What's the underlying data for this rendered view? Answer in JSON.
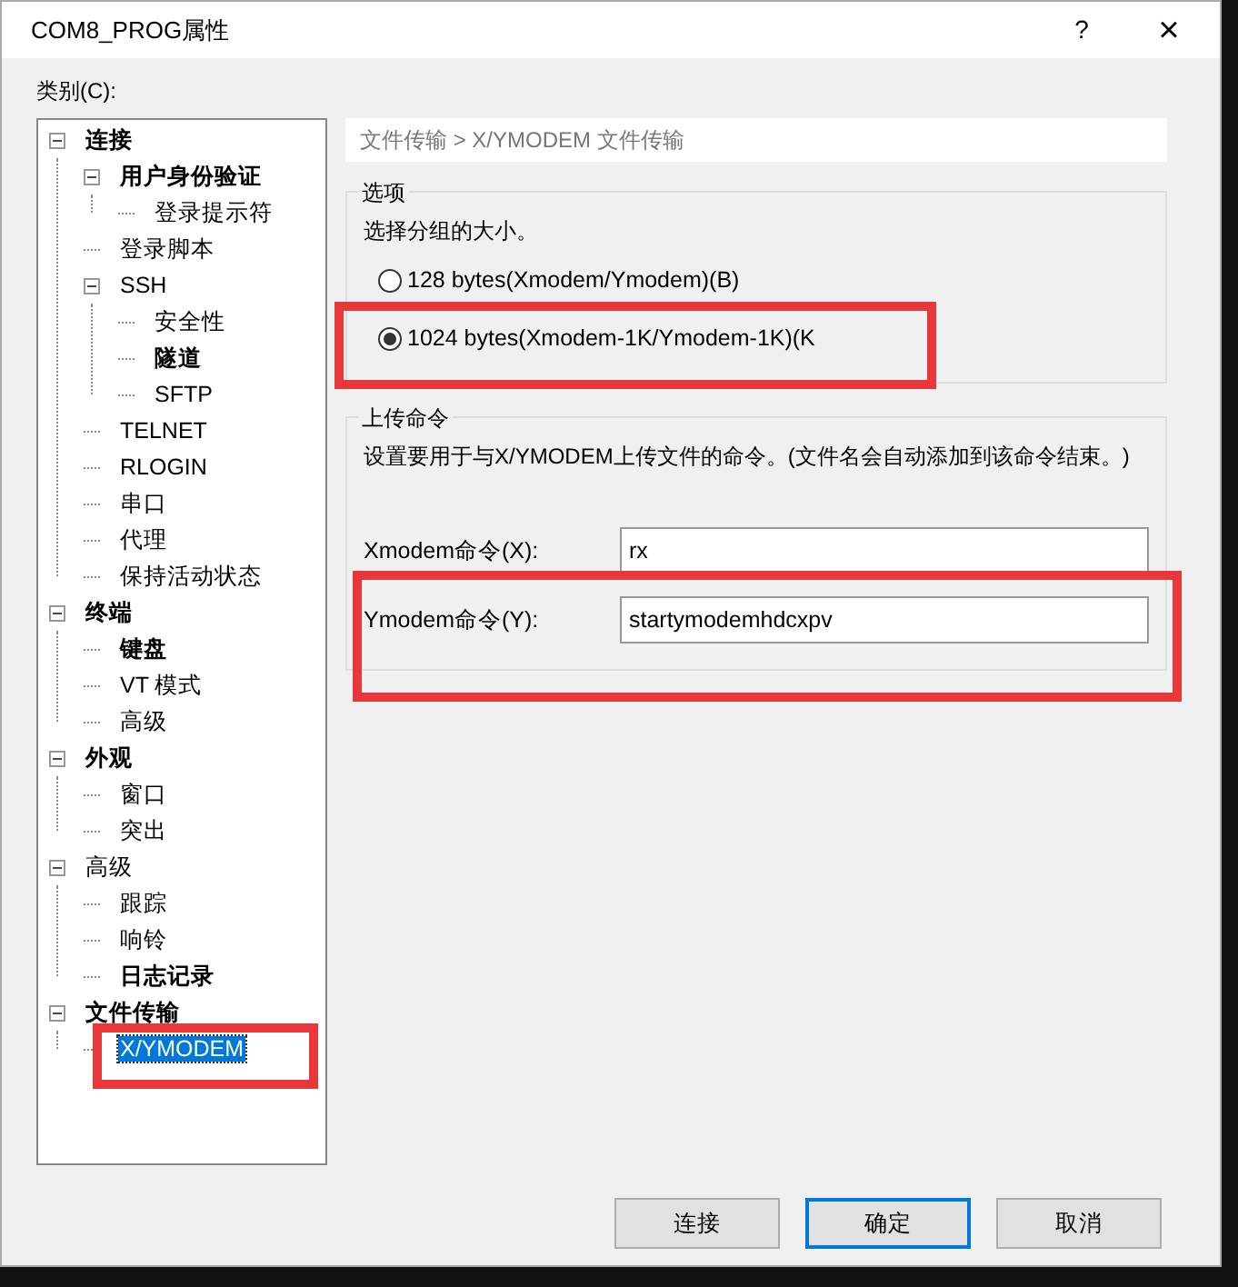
{
  "window": {
    "title": "COM8_PROG属性",
    "help": "?",
    "close": "×"
  },
  "category_label": "类别(C):",
  "tree": [
    {
      "label": "连接",
      "bold": true,
      "expanded": true,
      "selected": false,
      "highlighted": false,
      "children": [
        {
          "label": "用户身份验证",
          "bold": true,
          "expanded": true,
          "selected": false,
          "highlighted": false,
          "children": [
            {
              "label": "登录提示符",
              "bold": false,
              "selected": false,
              "highlighted": false
            }
          ]
        },
        {
          "label": "登录脚本",
          "bold": false,
          "selected": false,
          "highlighted": false
        },
        {
          "label": "SSH",
          "bold": false,
          "expanded": true,
          "selected": false,
          "highlighted": false,
          "children": [
            {
              "label": "安全性",
              "bold": false,
              "selected": false,
              "highlighted": false
            },
            {
              "label": "隧道",
              "bold": true,
              "selected": false,
              "highlighted": false
            },
            {
              "label": "SFTP",
              "bold": false,
              "selected": false,
              "highlighted": false
            }
          ]
        },
        {
          "label": "TELNET",
          "bold": false,
          "selected": false,
          "highlighted": false
        },
        {
          "label": "RLOGIN",
          "bold": false,
          "selected": false,
          "highlighted": false
        },
        {
          "label": "串口",
          "bold": false,
          "selected": false,
          "highlighted": false
        },
        {
          "label": "代理",
          "bold": false,
          "selected": false,
          "highlighted": false
        },
        {
          "label": "保持活动状态",
          "bold": false,
          "selected": false,
          "highlighted": false
        }
      ]
    },
    {
      "label": "终端",
      "bold": true,
      "expanded": true,
      "selected": false,
      "highlighted": false,
      "children": [
        {
          "label": "键盘",
          "bold": true,
          "selected": false,
          "highlighted": false
        },
        {
          "label": "VT 模式",
          "bold": false,
          "selected": false,
          "highlighted": false
        },
        {
          "label": "高级",
          "bold": false,
          "selected": false,
          "highlighted": false
        }
      ]
    },
    {
      "label": "外观",
      "bold": true,
      "expanded": true,
      "selected": false,
      "highlighted": false,
      "children": [
        {
          "label": "窗口",
          "bold": false,
          "selected": false,
          "highlighted": false
        },
        {
          "label": "突出",
          "bold": false,
          "selected": false,
          "highlighted": false
        }
      ]
    },
    {
      "label": "高级",
      "bold": false,
      "expanded": true,
      "selected": false,
      "highlighted": false,
      "children": [
        {
          "label": "跟踪",
          "bold": false,
          "selected": false,
          "highlighted": false
        },
        {
          "label": "响铃",
          "bold": false,
          "selected": false,
          "highlighted": false
        },
        {
          "label": "日志记录",
          "bold": true,
          "selected": false,
          "highlighted": false
        }
      ]
    },
    {
      "label": "文件传输",
      "bold": true,
      "expanded": true,
      "selected": false,
      "highlighted": false,
      "children": [
        {
          "label": "X/YMODEM",
          "bold": false,
          "selected": true,
          "highlighted": true
        }
      ]
    }
  ],
  "breadcrumb": "文件传输 > X/YMODEM 文件传输",
  "options_group": {
    "title": "选项",
    "description": "选择分组的大小。",
    "radios": [
      {
        "label": "128 bytes(Xmodem/Ymodem)(B)",
        "selected": false,
        "highlighted": false
      },
      {
        "label": "1024 bytes(Xmodem-1K/Ymodem-1K)(K",
        "selected": true,
        "highlighted": true
      }
    ]
  },
  "upload_group": {
    "title": "上传命令",
    "description": "设置要用于与X/YMODEM上传文件的命令。(文件名会自动添加到该命令结束。)",
    "fields": [
      {
        "label": "Xmodem命令(X):",
        "value": "rx",
        "highlighted": false
      },
      {
        "label": "Ymodem命令(Y):",
        "value": "startymodemhdcxpv",
        "highlighted": true
      }
    ]
  },
  "buttons": [
    {
      "label": "连接",
      "default": false
    },
    {
      "label": "确定",
      "default": true
    },
    {
      "label": "取消",
      "default": false
    }
  ]
}
